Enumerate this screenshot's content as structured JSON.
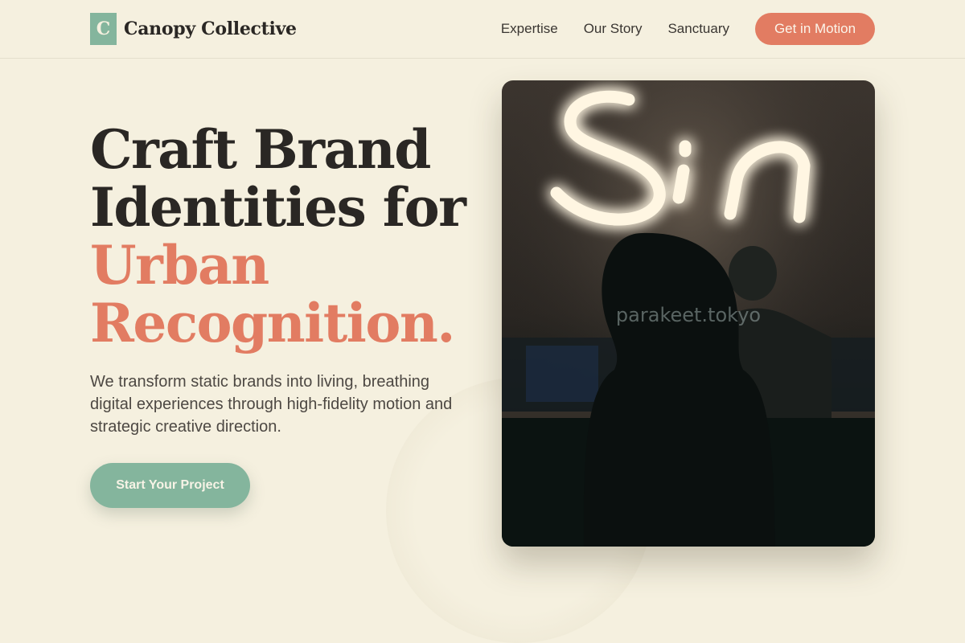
{
  "brand": {
    "logo_letter": "C",
    "name": "Canopy Collective",
    "accent_color": "#84b59d"
  },
  "nav": {
    "links": [
      "Expertise",
      "Our Story",
      "Sanctuary"
    ],
    "cta_label": "Get in Motion",
    "cta_color": "#e27c62"
  },
  "hero": {
    "title_line1": "Craft Brand",
    "title_line2": "Identities for",
    "title_accent_line1": "Urban",
    "title_accent_line2": "Recognition.",
    "subtitle": "We transform static brands into living, breathing digital experiences through high-fidelity motion and strategic creative direction.",
    "cta_label": "Start Your Project",
    "image": {
      "neon_text": "Sin",
      "watermark": "parakeet.tokyo"
    }
  },
  "colors": {
    "background": "#f5f0df",
    "text": "#2a2724"
  }
}
